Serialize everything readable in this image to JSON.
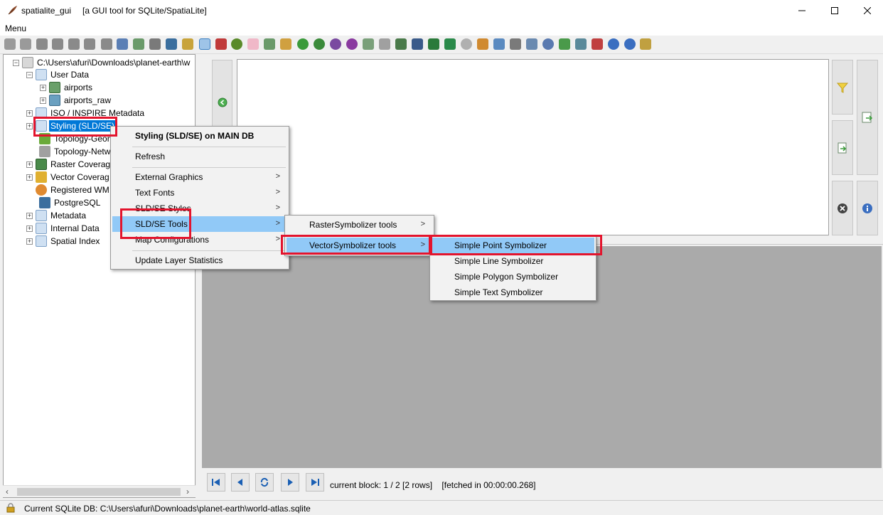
{
  "window": {
    "app_name": "spatialite_gui",
    "subtitle": "[a GUI tool for SQLite/SpatiaLite]",
    "minimize": "—",
    "maximize": "☐",
    "close": "✕"
  },
  "menubar": {
    "menu": "Menu"
  },
  "tree": {
    "root": "C:\\Users\\afuri\\Downloads\\planet-earth\\w",
    "user_data": "User Data",
    "airports": "airports",
    "airports_raw": "airports_raw",
    "iso_inspire": "ISO / INSPIRE Metadata",
    "styling": "Styling (SLD/SE)",
    "topology_geo": "Topology-Geor",
    "topology_net": "Topology-Netw",
    "raster_cov": "Raster Coverage",
    "vector_cov": "Vector Coverag",
    "registered_wms": "Registered WM",
    "postgresql": "PostgreSQL",
    "metadata": "Metadata",
    "internal_data": "Internal Data",
    "spatial_index": "Spatial Index"
  },
  "context_menu": {
    "header": "Styling (SLD/SE) on MAIN DB",
    "refresh": "Refresh",
    "external_graphics": "External Graphics",
    "text_fonts": "Text Fonts",
    "sld_se_styles": "SLD/SE Styles",
    "sld_se_tools": "SLD/SE Tools",
    "map_configurations": "Map Configurations",
    "update_layer_stats": "Update Layer Statistics"
  },
  "tools_submenu": {
    "raster_tools": "RasterSymbolizer tools",
    "vector_tools": "VectorSymbolizer tools"
  },
  "vector_submenu": {
    "point": "Simple Point Symbolizer",
    "line": "Simple Line Symbolizer",
    "polygon": "Simple Polygon Symbolizer",
    "text": "Simple Text Symbolizer"
  },
  "results": {
    "block_info": "current block: 1 / 2 [2 rows]",
    "fetch_info": "[fetched in 00:00:00.268]"
  },
  "status": {
    "db_path": "Current SQLite DB: C:\\Users\\afuri\\Downloads\\planet-earth\\world-atlas.sqlite"
  },
  "colors": {
    "selection": "#0078d7",
    "menu_highlight": "#91c9f7",
    "annotation_red": "#e3142d"
  }
}
